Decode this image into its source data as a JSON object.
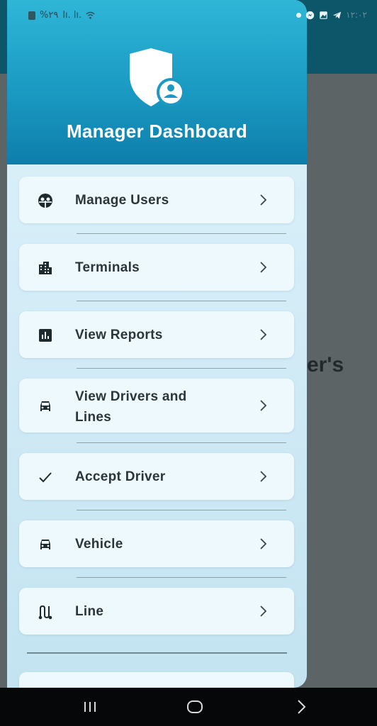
{
  "status_bar": {
    "left_text": "%۲۹",
    "signal_text": "lı. lı.",
    "time": "۱۲:۰۲"
  },
  "background_app": {
    "visible_text": "er's"
  },
  "drawer": {
    "title": "Manager Dashboard",
    "items": [
      {
        "label": "Manage Users",
        "icon": "manage-users-icon"
      },
      {
        "label": "Terminals",
        "icon": "building-icon"
      },
      {
        "label": "View Reports",
        "icon": "reports-icon"
      },
      {
        "label": "View Drivers and Lines",
        "icon": "car-icon"
      },
      {
        "label": "Accept Driver",
        "icon": "check-icon"
      },
      {
        "label": "Vehicle",
        "icon": "car-icon"
      },
      {
        "label": "Line",
        "icon": "route-icon"
      }
    ]
  },
  "colors": {
    "header_gradient_top": "#2fb6d7",
    "header_gradient_bottom": "#0e7eab",
    "drawer_bg": "#d6eef8",
    "item_bg": "#eef9fd",
    "appbar": "#0d5568"
  }
}
